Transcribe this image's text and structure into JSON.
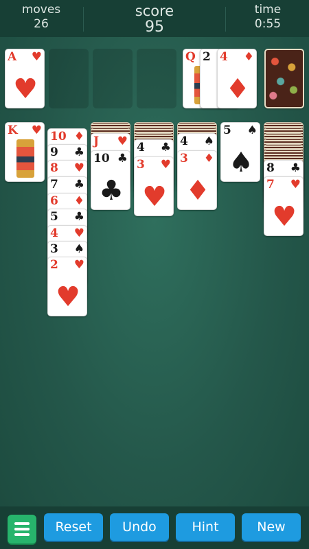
{
  "header": {
    "moves_label": "moves",
    "moves_value": "26",
    "score_label": "score",
    "score_value": "95",
    "time_label": "time",
    "time_value": "0:55"
  },
  "colors": {
    "felt": "#24574a",
    "bar": "#173f35",
    "button": "#1e9be0",
    "menu_button": "#27b46c",
    "red_suit": "#e23b2c"
  },
  "foundation": [
    {
      "rank": "A",
      "suit": "♥",
      "color": "red"
    }
  ],
  "waste": [
    {
      "rank": "Q",
      "suit": "♥",
      "color": "red"
    },
    {
      "rank": "2",
      "suit": "♠",
      "color": "black"
    },
    {
      "rank": "4",
      "suit": "♦",
      "color": "red"
    }
  ],
  "stock": {
    "face_down": true
  },
  "tableau": {
    "col1": [
      {
        "rank": "K",
        "suit": "♥",
        "color": "red"
      }
    ],
    "col2": [
      {
        "rank": "10",
        "suit": "♦",
        "color": "red"
      },
      {
        "rank": "9",
        "suit": "♣",
        "color": "black"
      },
      {
        "rank": "8",
        "suit": "♥",
        "color": "red"
      },
      {
        "rank": "7",
        "suit": "♣",
        "color": "black"
      },
      {
        "rank": "6",
        "suit": "♦",
        "color": "red"
      },
      {
        "rank": "5",
        "suit": "♣",
        "color": "black"
      },
      {
        "rank": "4",
        "suit": "♥",
        "color": "red"
      },
      {
        "rank": "3",
        "suit": "♠",
        "color": "black"
      },
      {
        "rank": "2",
        "suit": "♥",
        "color": "red"
      }
    ],
    "col3": [
      {
        "rank": "J",
        "suit": "♥",
        "color": "red"
      },
      {
        "rank": "10",
        "suit": "♣",
        "color": "black"
      }
    ],
    "col4": [
      {
        "rank": "4",
        "suit": "♣",
        "color": "black"
      },
      {
        "rank": "3",
        "suit": "♥",
        "color": "red"
      }
    ],
    "col5": [
      {
        "rank": "4",
        "suit": "♠",
        "color": "black"
      },
      {
        "rank": "3",
        "suit": "♦",
        "color": "red"
      }
    ],
    "col6": [
      {
        "rank": "5",
        "suit": "♠",
        "color": "black"
      }
    ],
    "col7": [
      {
        "rank": "8",
        "suit": "♣",
        "color": "black"
      },
      {
        "rank": "7",
        "suit": "♥",
        "color": "red"
      }
    ]
  },
  "buttons": {
    "menu_icon": "hamburger-icon",
    "reset": "Reset",
    "undo": "Undo",
    "hint": "Hint",
    "new": "New"
  }
}
